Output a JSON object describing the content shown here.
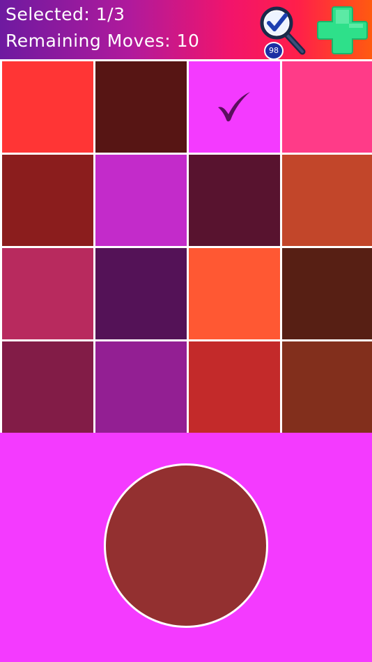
{
  "hud": {
    "selected_label": "Selected: 1/3",
    "moves_label": "Remaining Moves: 10"
  },
  "hint": {
    "icon": "magnifier-check-icon",
    "count": "98"
  },
  "add": {
    "icon": "plus-icon",
    "color": "#2ee08a"
  },
  "grid": {
    "tiles": [
      {
        "color": "#ff3535",
        "selected": false
      },
      {
        "color": "#571514",
        "selected": false
      },
      {
        "color": "#f43aff",
        "selected": true
      },
      {
        "color": "#ff3b88",
        "selected": false
      },
      {
        "color": "#8b1d1d",
        "selected": false
      },
      {
        "color": "#c32bca",
        "selected": false
      },
      {
        "color": "#58132f",
        "selected": false
      },
      {
        "color": "#c2462a",
        "selected": false
      },
      {
        "color": "#b82a5e",
        "selected": false
      },
      {
        "color": "#541257",
        "selected": false
      },
      {
        "color": "#ff5833",
        "selected": false
      },
      {
        "color": "#571f14",
        "selected": false
      },
      {
        "color": "#821c47",
        "selected": false
      },
      {
        "color": "#931f93",
        "selected": false
      },
      {
        "color": "#c32a2a",
        "selected": false
      },
      {
        "color": "#822f1c",
        "selected": false
      }
    ]
  },
  "target": {
    "color": "#933030"
  },
  "colors": {
    "background": "#f43aff",
    "check_mark": "#5a0f5e"
  }
}
